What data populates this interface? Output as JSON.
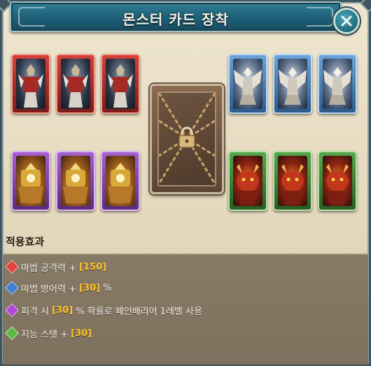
{
  "window": {
    "title": "몬스터 카드 장착"
  },
  "cards": {
    "red": [
      "red-card",
      "red-card",
      "red-card"
    ],
    "blue": [
      "blue-card",
      "blue-card",
      "blue-card"
    ],
    "purple": [
      "purple-card",
      "purple-card",
      "purple-card"
    ],
    "green": [
      "green-card",
      "green-card",
      "green-card"
    ]
  },
  "locked_slot": {
    "icon": "padlock-icon"
  },
  "effects": {
    "heading": "적용효과",
    "rows": [
      {
        "gem_color": "#e0453d",
        "pre": "마법 공격력 + ",
        "value": "[150]",
        "post": ""
      },
      {
        "gem_color": "#3f7fd6",
        "pre": "마법 방어력 + ",
        "value": "[30]",
        "post": " %"
      },
      {
        "gem_color": "#b04ad6",
        "pre": "피격 시 ",
        "value": "[30]",
        "post": " % 확률로 페인배리어 1레벨 사용"
      },
      {
        "gem_color": "#5cb845",
        "pre": "지능 스텟 + ",
        "value": "[30]",
        "post": ""
      }
    ]
  },
  "colors": {
    "title_bar": "#1e5f77",
    "value_highlight": "#ffc22a"
  }
}
